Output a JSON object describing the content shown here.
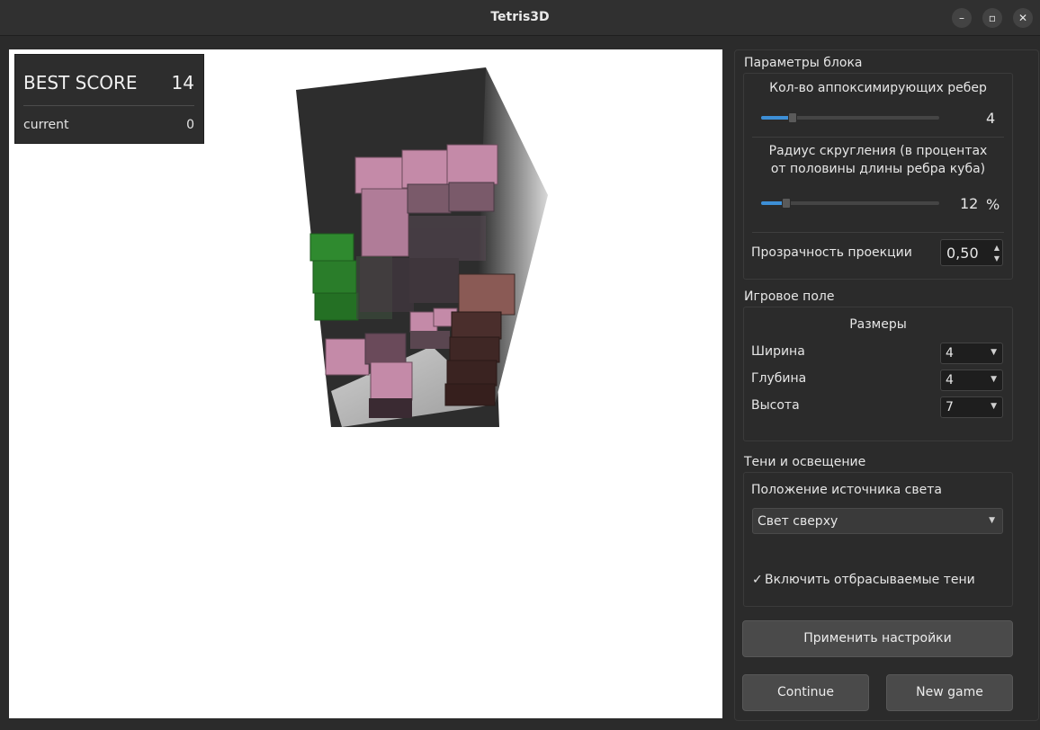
{
  "window": {
    "title": "Tetris3D",
    "minimize_icon": "minimize-icon",
    "maximize_icon": "maximize-icon",
    "close_icon": "close-icon"
  },
  "score": {
    "best_label": "BEST SCORE",
    "best_value": "14",
    "current_label": "current",
    "current_value": "0"
  },
  "block_params": {
    "title": "Параметры блока",
    "edges_label": "Кол-во аппоксимирующих ребер",
    "edges_value": "4",
    "radius_label_line1": "Радиус скругления (в процентах",
    "radius_label_line2": "от половины длины ребра куба)",
    "radius_value": "12",
    "radius_unit": "%",
    "opacity_label": "Прозрачность проекции",
    "opacity_value": "0,50"
  },
  "field": {
    "title": "Игровое поле",
    "sizes_label": "Размеры",
    "width_label": "Ширина",
    "width_value": "4",
    "depth_label": "Глубина",
    "depth_value": "4",
    "height_label": "Высота",
    "height_value": "7"
  },
  "lighting": {
    "title": "Тени и освещение",
    "light_pos_label": "Положение источника света",
    "light_pos_value": "Свет сверху",
    "shadows_checked": true,
    "shadows_label": "Включить отбрасываемые тени"
  },
  "buttons": {
    "apply": "Применить настройки",
    "continue": "Continue",
    "new_game": "New game"
  },
  "colors": {
    "accent": "#3d8fd6",
    "cube_pink": "#c48aa8",
    "cube_green": "#2e8a2e",
    "cube_brown": "#8a5a55"
  }
}
